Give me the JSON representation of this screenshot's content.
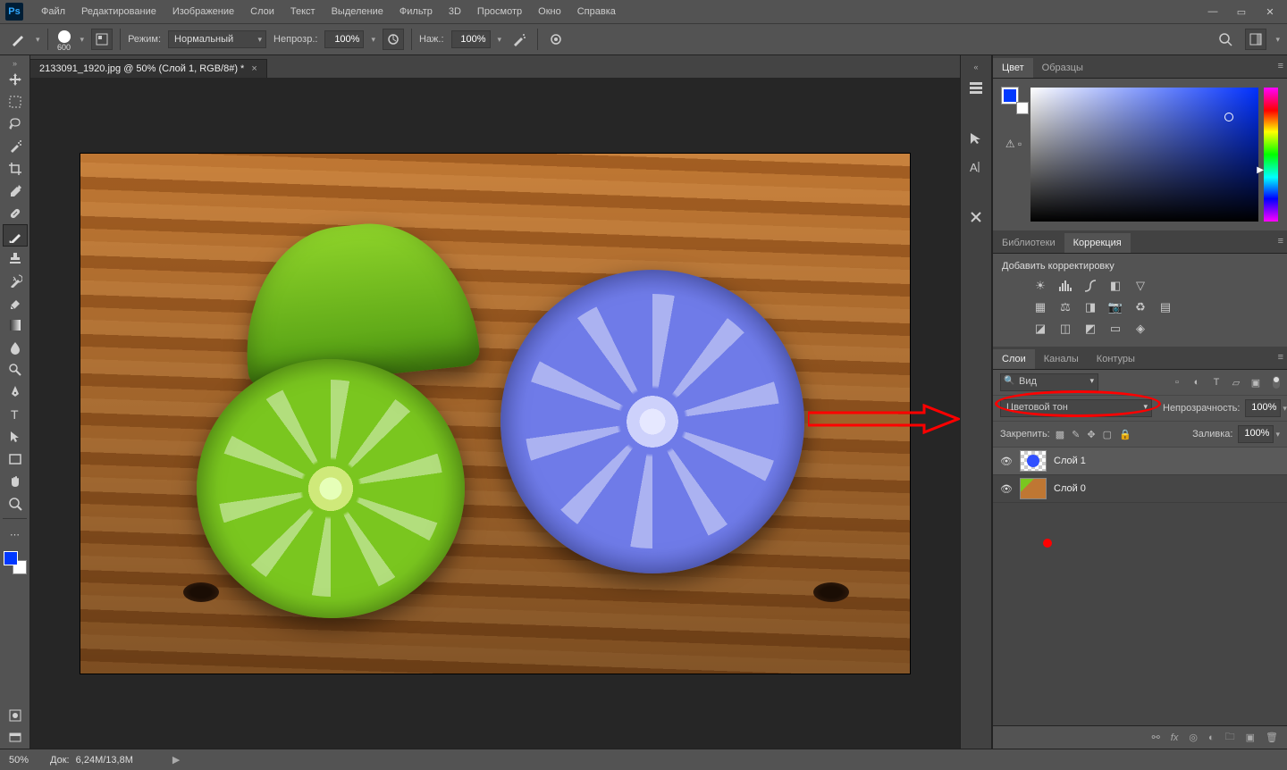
{
  "menu": [
    "Файл",
    "Редактирование",
    "Изображение",
    "Слои",
    "Текст",
    "Выделение",
    "Фильтр",
    "3D",
    "Просмотр",
    "Окно",
    "Справка"
  ],
  "options": {
    "brush_size": "600",
    "mode_label": "Режим:",
    "mode_value": "Нормальный",
    "opacity_label": "Непрозр.:",
    "opacity_value": "100%",
    "flow_label": "Наж.:",
    "flow_value": "100%"
  },
  "doc": {
    "tab_title": "2133091_1920.jpg @ 50% (Слой 1, RGB/8#) *"
  },
  "status": {
    "zoom": "50%",
    "doc_label": "Док:",
    "doc_value": "6,24M/13,8M"
  },
  "panels": {
    "color_tabs": [
      "Цвет",
      "Образцы"
    ],
    "lib_tabs": [
      "Библиотеки",
      "Коррекция"
    ],
    "adjust_title": "Добавить корректировку",
    "layer_tabs": [
      "Слои",
      "Каналы",
      "Контуры"
    ],
    "kind_value": "Вид",
    "blend_value": "Цветовой тон",
    "opacity_label": "Непрозрачность:",
    "opacity_value": "100%",
    "lock_label": "Закрепить:",
    "fill_label": "Заливка:",
    "fill_value": "100%",
    "layers": [
      {
        "name": "Слой 1",
        "active": true,
        "thumb": "trans"
      },
      {
        "name": "Слой 0",
        "active": false,
        "thumb": "img"
      }
    ]
  }
}
